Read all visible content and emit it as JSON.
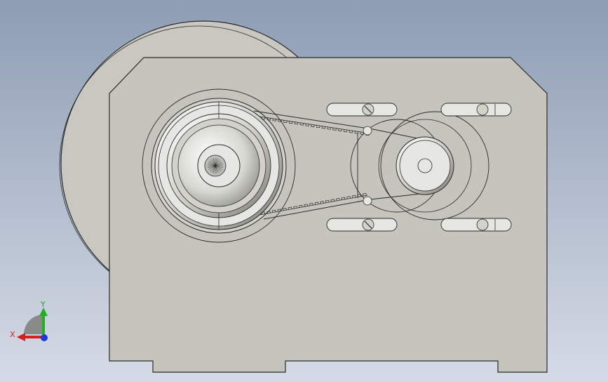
{
  "viewport": {
    "background_top": "#8e9db4",
    "background_bottom": "#d5dbe6"
  },
  "colors": {
    "housing_fill": "#c5c4bd",
    "flywheel_fill": "#c8c7c0",
    "edge": "#2a2a2a",
    "pulley_light": "#e6e6e2",
    "pulley_mid": "#d2d1ca",
    "pulley_dark": "#9b9a93",
    "axis_x": "#d82020",
    "axis_y": "#20b020",
    "axis_z": "#1a3ad8",
    "triad_base": "#8a8a8a"
  },
  "triad": {
    "x_label": "X",
    "y_label": "Y"
  }
}
